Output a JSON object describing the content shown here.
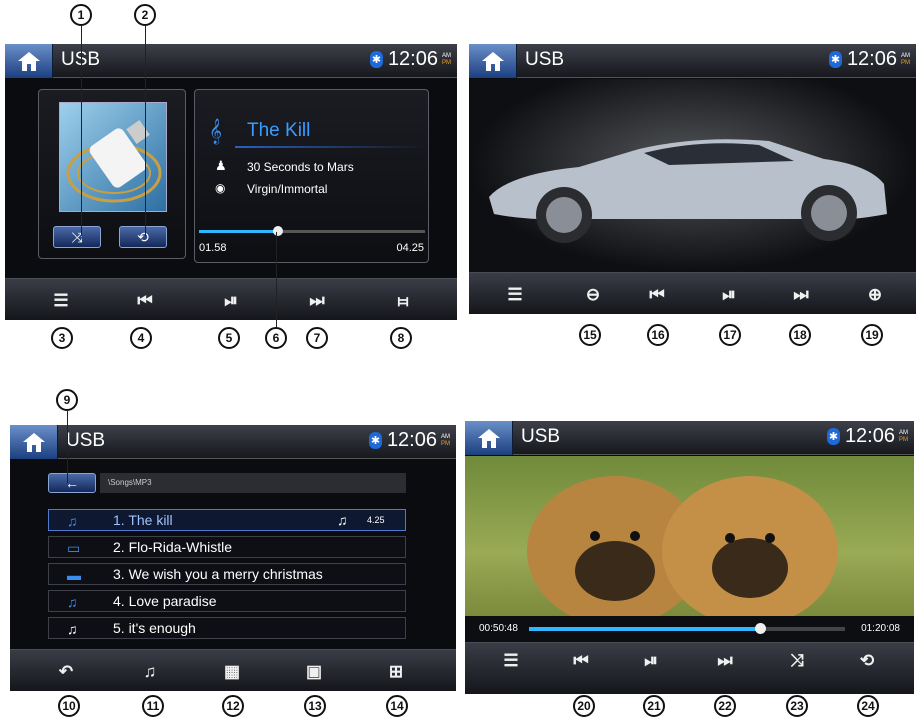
{
  "screens": {
    "music": {
      "source": "USB",
      "clock": "12:06",
      "am": "AM",
      "pm": "PM",
      "title": "The Kill",
      "artist": "30 Seconds to Mars",
      "album": "Virgin/Immortal",
      "elapsed": "01.58",
      "total": "04.25",
      "progress": 0.35
    },
    "photo": {
      "source": "USB",
      "clock": "12:06",
      "am": "AM",
      "pm": "PM"
    },
    "list": {
      "source": "USB",
      "clock": "12:06",
      "am": "AM",
      "pm": "PM",
      "path": "\\Songs\\MP3",
      "duration": "4.25",
      "items": [
        {
          "label": "1.  The kill"
        },
        {
          "label": "2.  Flo-Rida-Whistle"
        },
        {
          "label": "3.  We wish you a merry christmas"
        },
        {
          "label": "4.  Love paradise"
        },
        {
          "label": "5.  it's enough"
        }
      ]
    },
    "video": {
      "source": "USB",
      "clock": "12:06",
      "am": "AM",
      "pm": "PM",
      "elapsed": "00:50:48",
      "total": "01:20:08",
      "progress": 0.73
    }
  },
  "callouts": [
    "1",
    "2",
    "3",
    "4",
    "5",
    "6",
    "7",
    "8",
    "9",
    "10",
    "11",
    "12",
    "13",
    "14",
    "15",
    "16",
    "17",
    "18",
    "19",
    "20",
    "21",
    "22",
    "23",
    "24"
  ]
}
